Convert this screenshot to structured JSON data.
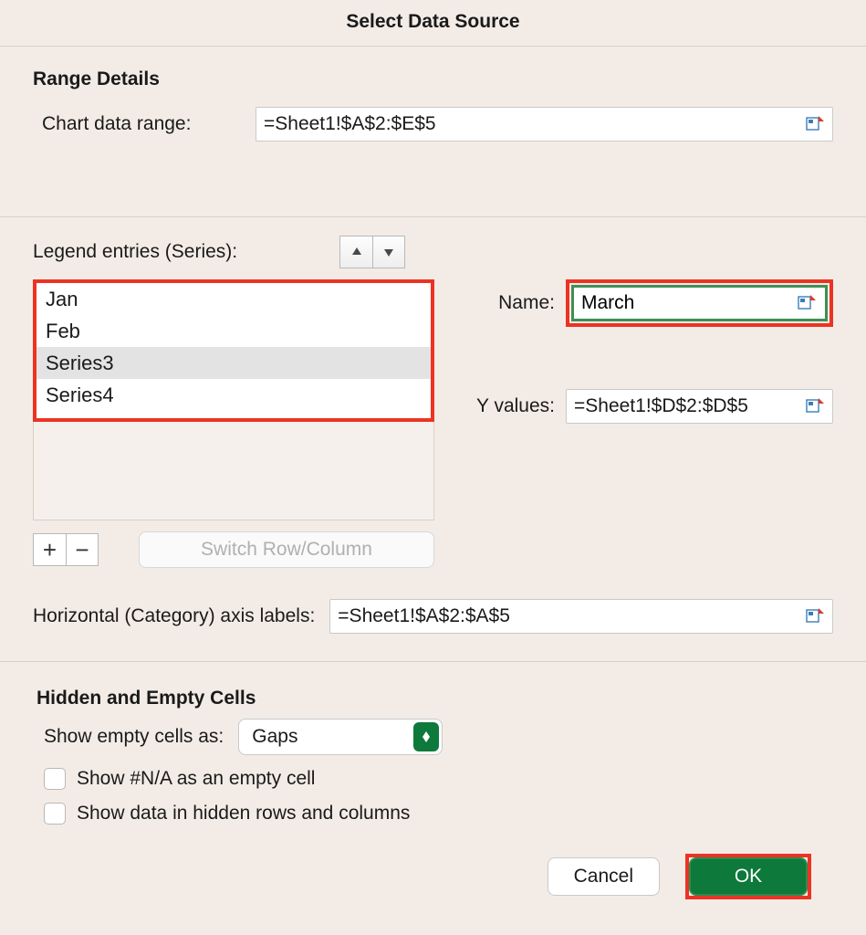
{
  "dialog": {
    "title": "Select Data Source"
  },
  "range": {
    "section_header": "Range Details",
    "chart_data_range_label": "Chart data range:",
    "chart_data_range_value": "=Sheet1!$A$2:$E$5"
  },
  "series": {
    "legend_label": "Legend entries (Series):",
    "items": [
      "Jan",
      "Feb",
      "Series3",
      "Series4"
    ],
    "selected_index": 2,
    "switch_label": "Switch Row/Column",
    "name_label": "Name:",
    "name_value": "March",
    "yvalues_label": "Y values:",
    "yvalues_value": "=Sheet1!$D$2:$D$5"
  },
  "axis": {
    "horizontal_label": "Horizontal (Category) axis labels:",
    "horizontal_value": "=Sheet1!$A$2:$A$5"
  },
  "hidden": {
    "section_header": "Hidden and Empty Cells",
    "show_empty_label": "Show empty cells as:",
    "show_empty_value": "Gaps",
    "na_label": "Show #N/A as an empty cell",
    "hidden_rows_label": "Show data in hidden rows and columns"
  },
  "footer": {
    "cancel": "Cancel",
    "ok": "OK"
  }
}
